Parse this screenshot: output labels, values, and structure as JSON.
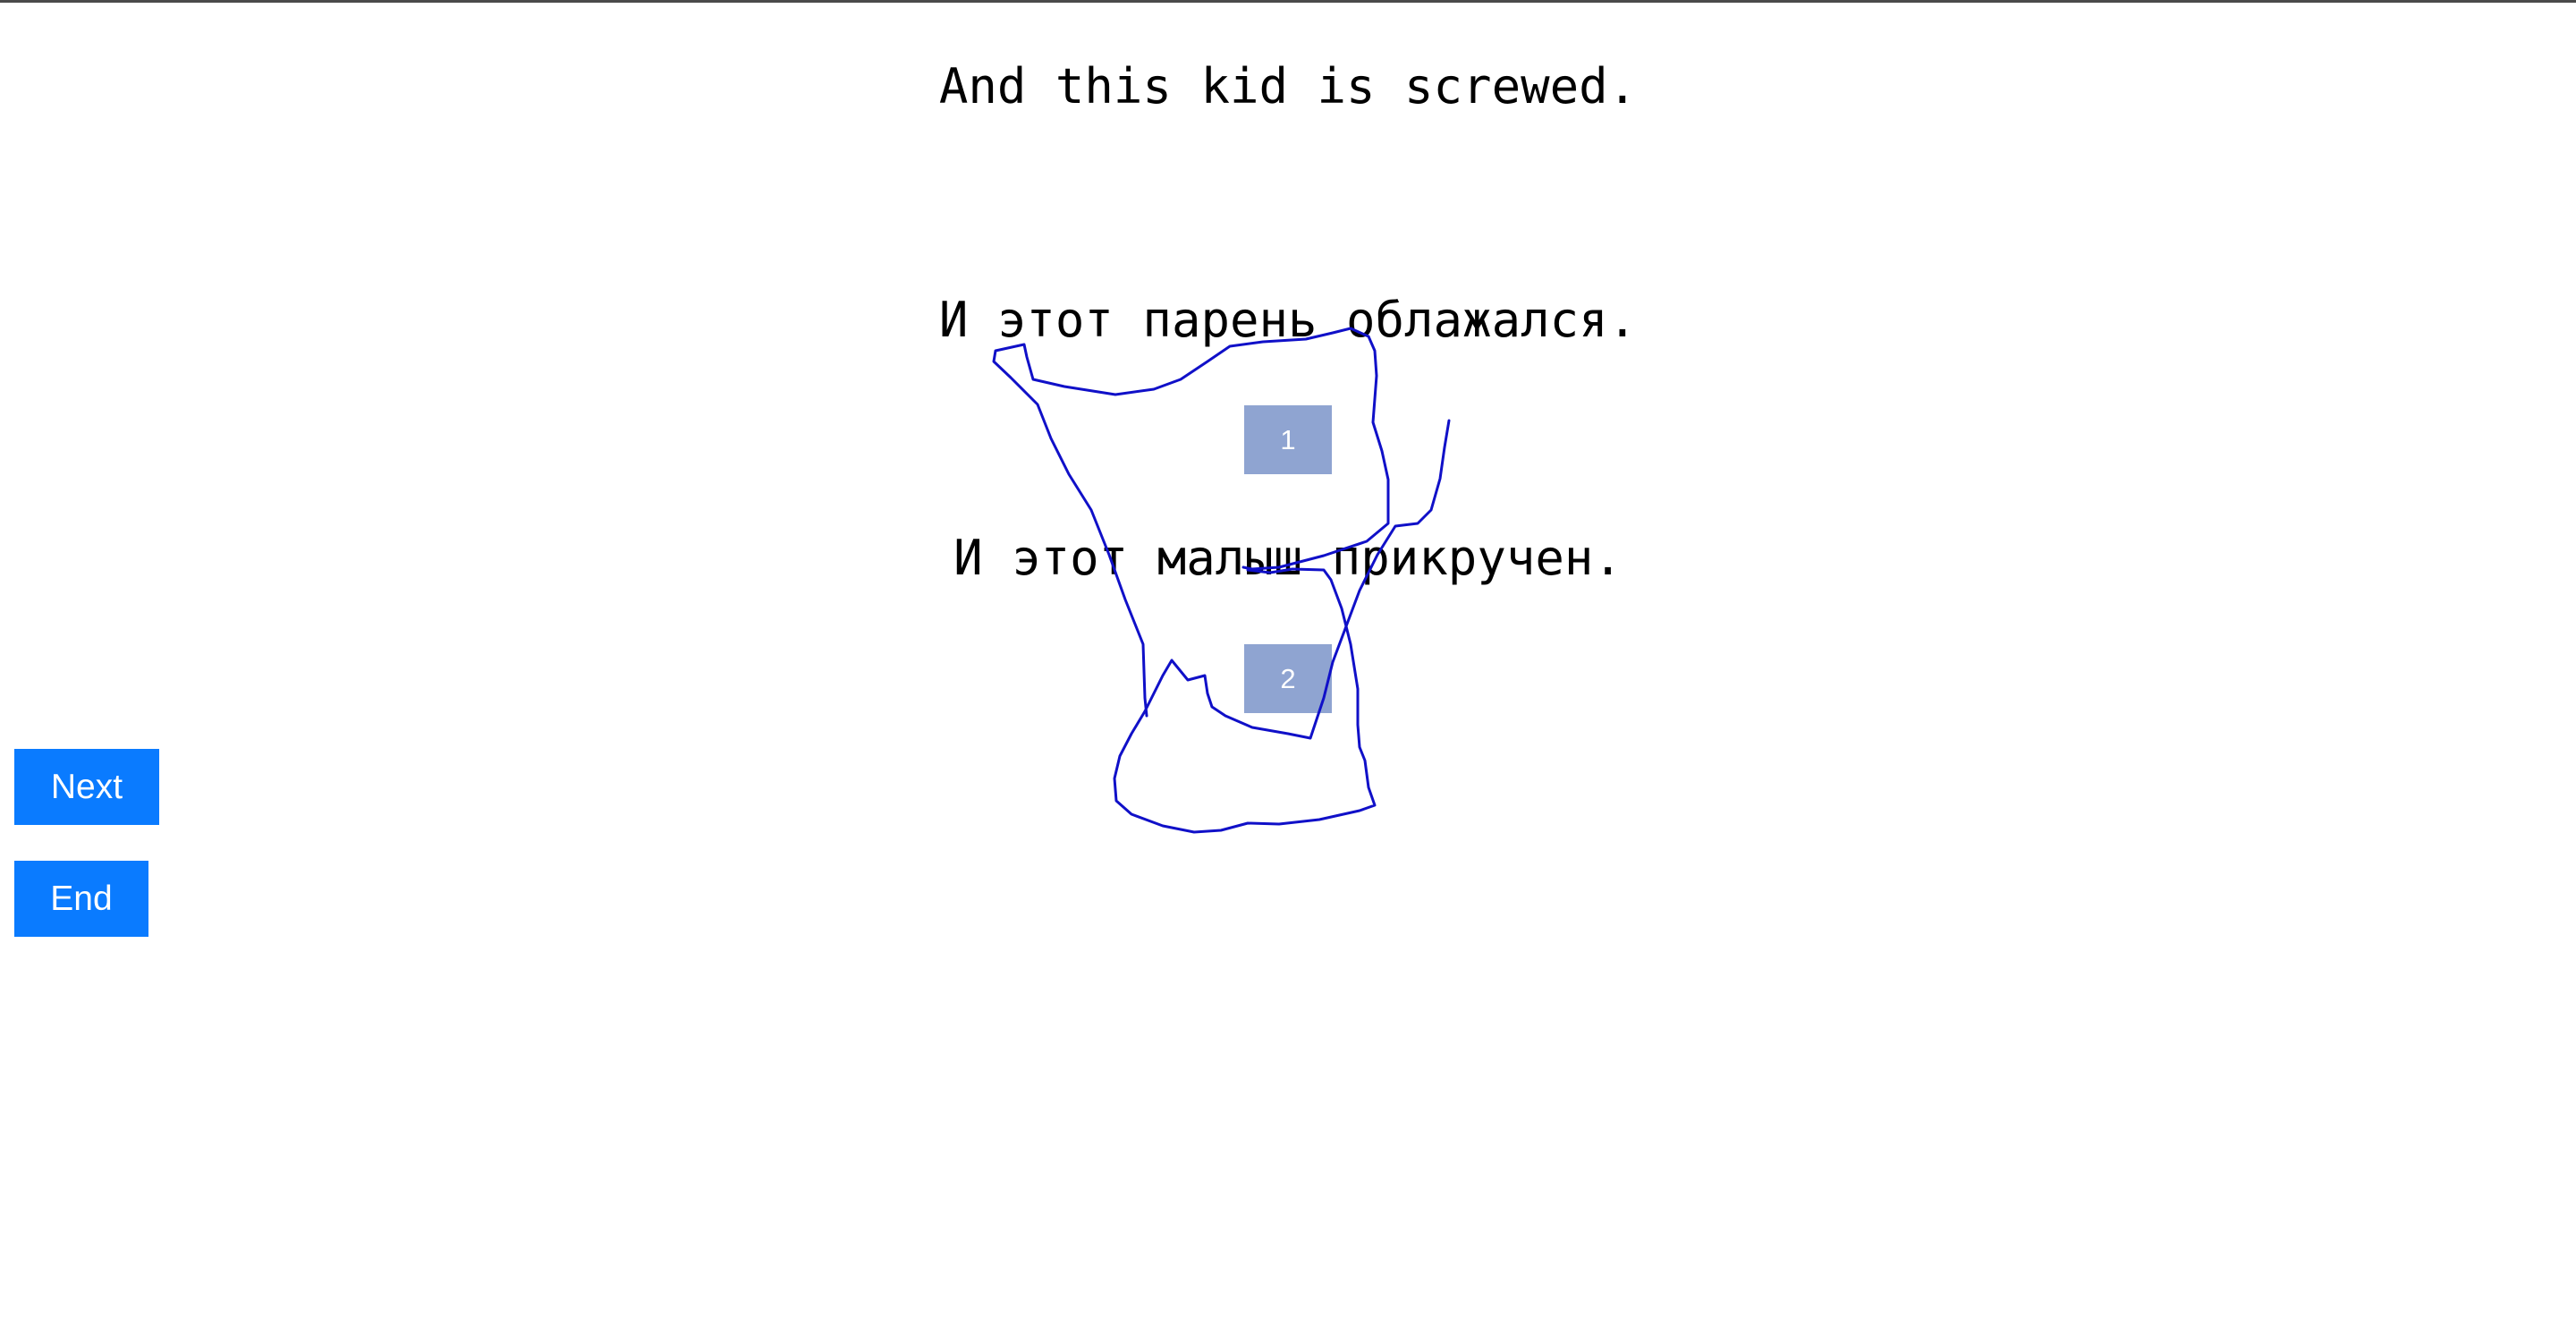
{
  "source_sentence": "And this kid is screwed.",
  "translations": [
    "И этот парень облажался.",
    "И этот малыш прикручен."
  ],
  "choices": [
    "1",
    "2"
  ],
  "buttons": {
    "next_label": "Next",
    "end_label": "End"
  },
  "colors": {
    "button_bg": "#0a7bff",
    "choice_bg": "#8fa4d1",
    "scribble": "#1010c8"
  }
}
